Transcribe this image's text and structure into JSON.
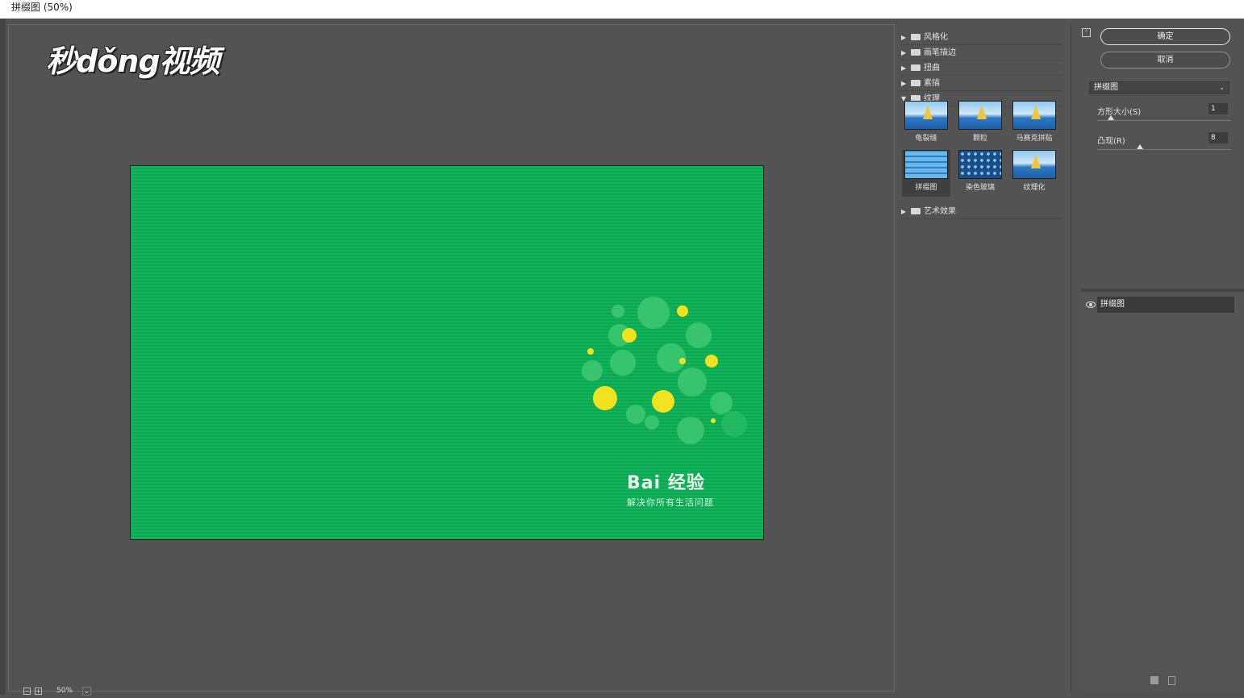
{
  "window": {
    "title": "拼缀图 (50%)"
  },
  "preview": {
    "watermark": "秒dǒng视频",
    "image": {
      "brand_title": "Bai 经验",
      "brand_subtitle": "解决你所有生活问题"
    },
    "zoom": {
      "minus": "−",
      "plus": "+",
      "level": "50%",
      "dropdown": "⌄"
    }
  },
  "filter_gallery": {
    "categories_top": [
      {
        "label": "风格化",
        "expanded": false
      },
      {
        "label": "画笔描边",
        "expanded": false
      },
      {
        "label": "扭曲",
        "expanded": false
      },
      {
        "label": "素描",
        "expanded": false
      },
      {
        "label": "纹理",
        "expanded": true
      }
    ],
    "texture_filters": [
      {
        "label": "龟裂缝"
      },
      {
        "label": "颗粒"
      },
      {
        "label": "马赛克拼贴"
      },
      {
        "label": "拼缀图",
        "selected": true
      },
      {
        "label": "染色玻璃"
      },
      {
        "label": "纹理化"
      }
    ],
    "categories_bottom": [
      {
        "label": "艺术效果",
        "expanded": false
      }
    ]
  },
  "controls": {
    "ok_label": "确定",
    "cancel_label": "取消",
    "filter_select": "拼缀图",
    "params": [
      {
        "label": "方形大小(S)",
        "value": "1",
        "fraction": 0.1
      },
      {
        "label": "凸现(R)",
        "value": "8",
        "fraction": 0.32
      }
    ],
    "effect_layer": "拼缀图"
  },
  "colors": {
    "canvas_green": "#11b45a",
    "panel_bg": "#535353",
    "title_bg": "#ffffff"
  }
}
